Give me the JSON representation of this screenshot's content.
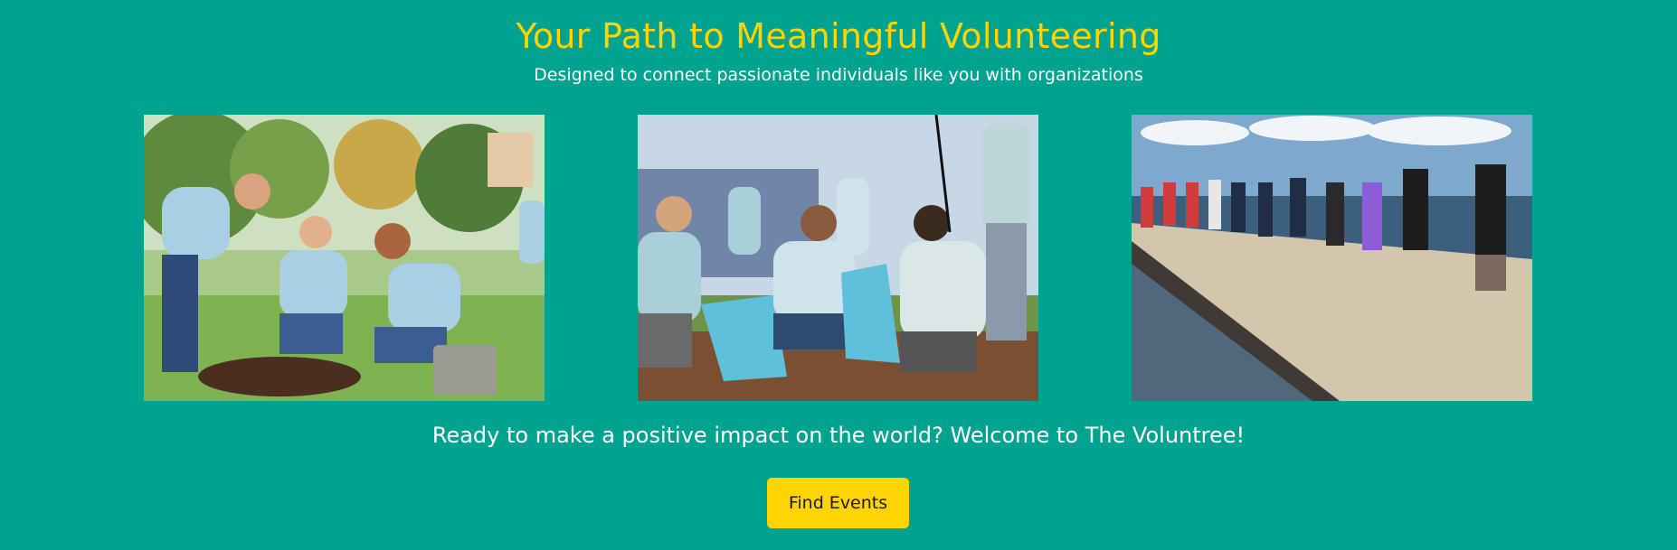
{
  "hero": {
    "title": "Your Path to Meaningful Volunteering",
    "subtitle": "Designed to connect passionate individuals like you with organizations",
    "tagline": "Ready to make a positive impact on the world? Welcome to The Voluntree!",
    "cta_label": "Find Events"
  },
  "photos": [
    {
      "name": "tree-planting-photo"
    },
    {
      "name": "park-cleanup-photo"
    },
    {
      "name": "coastal-cleanup-photo"
    }
  ],
  "colors": {
    "background": "#00a38f",
    "title": "#ffd400",
    "body_text": "#ffffff",
    "button_bg": "#ffd400",
    "button_text": "#1a1a1a"
  }
}
